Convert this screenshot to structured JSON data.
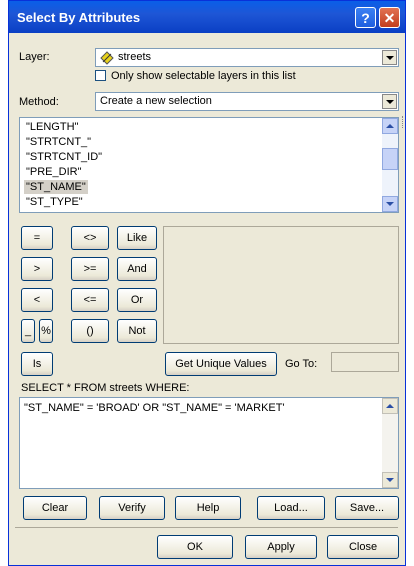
{
  "window": {
    "title": "Select By Attributes",
    "help_glyph": "?",
    "close_glyph": "✕"
  },
  "layer": {
    "label": "Layer:",
    "value": "streets",
    "icon": "layer-diamond-icon"
  },
  "only_selectable": {
    "label": "Only show selectable layers in this list",
    "checked": false
  },
  "method": {
    "label": "Method:",
    "value": "Create a new selection"
  },
  "fields": [
    "\"LENGTH\"",
    "\"STRTCNT_\"",
    "\"STRTCNT_ID\"",
    "\"PRE_DIR\"",
    "\"ST_NAME\"",
    "\"ST_TYPE\""
  ],
  "selected_field": "\"ST_NAME\"",
  "operators": {
    "eq": "=",
    "ne": "<>",
    "like": "Like",
    "gt": ">",
    "ge": ">=",
    "and": "And",
    "lt": "<",
    "le": "<=",
    "or": "Or",
    "underscore": "_",
    "percent": "%",
    "parens": "()",
    "not": "Not",
    "is": "Is"
  },
  "get_unique_values": "Get Unique Values",
  "goto_label": "Go To:",
  "goto_value": "",
  "sql_label": "SELECT * FROM streets WHERE:",
  "sql_text": "\"ST_NAME\" = 'BROAD' OR \"ST_NAME\" = 'MARKET'",
  "row_buttons": {
    "clear": "Clear",
    "verify": "Verify",
    "help": "Help",
    "load": "Load...",
    "save": "Save..."
  },
  "bottom_buttons": {
    "ok": "OK",
    "apply": "Apply",
    "close": "Close"
  }
}
